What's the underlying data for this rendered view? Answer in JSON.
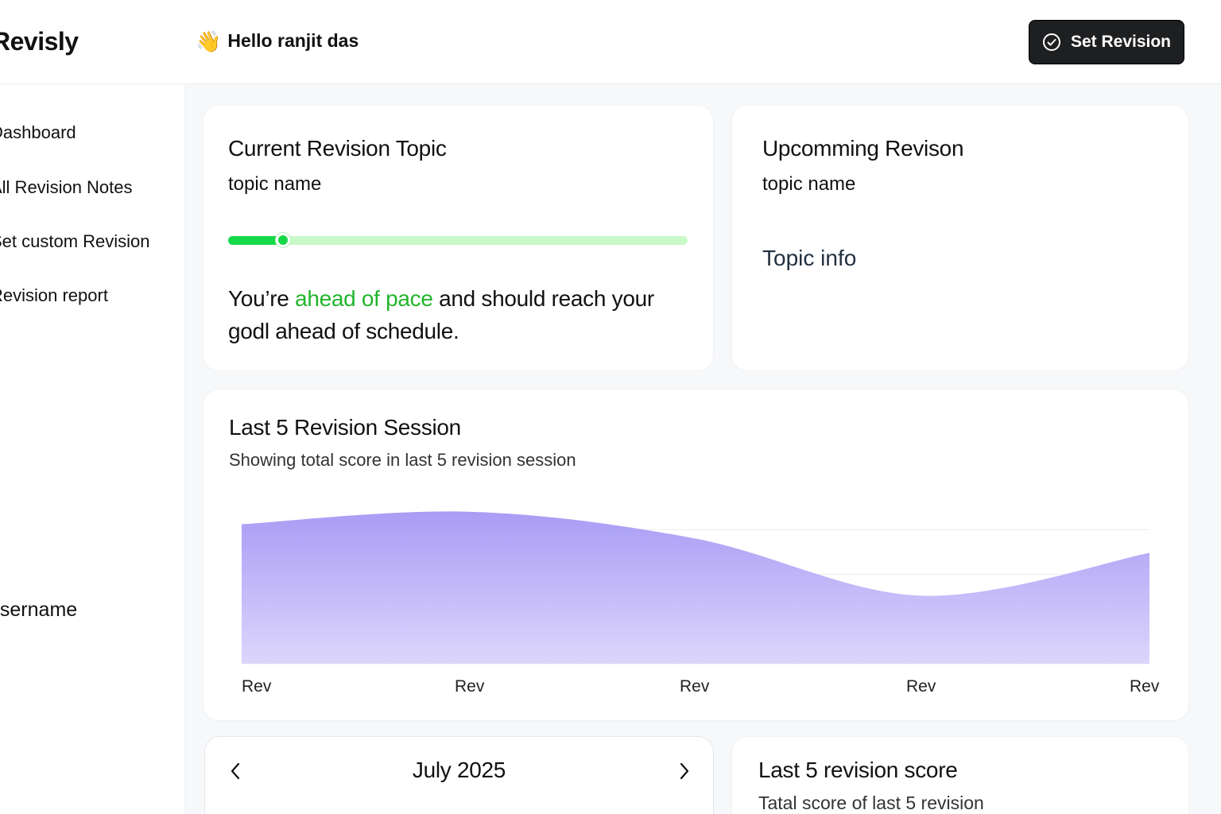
{
  "app": {
    "brand": "Revisly",
    "greeting_emoji": "👋",
    "greeting": "Hello ranjit das",
    "set_revision_button": "Set Revision"
  },
  "sidebar": {
    "items": [
      {
        "label": "Dashboard",
        "icon": "none"
      },
      {
        "label": "All Revision Notes",
        "icon": "none"
      },
      {
        "label": "Set custom Revision",
        "icon": "none"
      },
      {
        "label": "Revision report",
        "icon": "none"
      }
    ],
    "username": "username"
  },
  "current_topic": {
    "title": "Current Revision Topic",
    "topic": "topic name",
    "progress_fraction": 0.12,
    "pace_prefix": "You’re ",
    "pace_highlight": "ahead of pace",
    "pace_suffix": " and should reach your godl ahead of schedule."
  },
  "upcoming": {
    "title": "Upcomming Revison",
    "topic": "topic name",
    "info": "Topic info"
  },
  "chart_section": {
    "title": "Last 5 Revision Session",
    "subtitle": "Showing total score in last 5 revision session"
  },
  "chart_data": {
    "type": "area",
    "categories": [
      "Rev",
      "Rev",
      "Rev",
      "Rev",
      "Rev"
    ],
    "values": [
      78,
      85,
      70,
      38,
      62
    ],
    "ylim": [
      0,
      100
    ],
    "grid": true,
    "legend": "none",
    "colors": {
      "fill_top": "#a99cf5",
      "fill_bottom": "#dcd6fc"
    }
  },
  "calendar": {
    "month": "July 2025",
    "prev_icon": "chevron-left-icon",
    "next_icon": "chevron-right-icon"
  },
  "score": {
    "title": "Last 5 revision score",
    "subtitle": "Tatal score of last 5 revision"
  },
  "colors": {
    "accent_green": "#16d94a",
    "track_green": "#c9f8c9",
    "highlight_green": "#22b52c",
    "button_dark": "#1e1f21",
    "chart_purple": "#a99cf5"
  }
}
